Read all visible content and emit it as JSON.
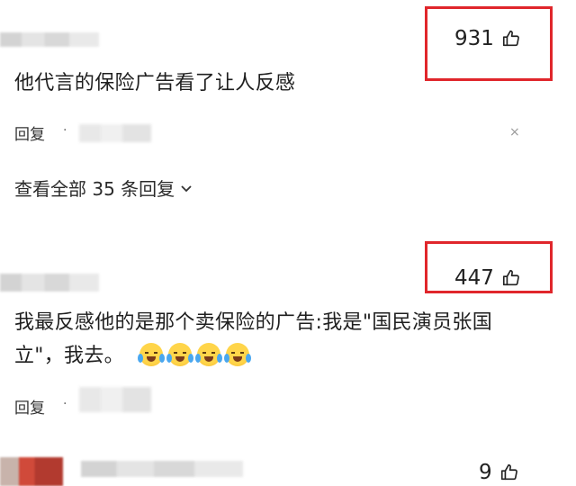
{
  "comments": [
    {
      "text": "他代言的保险广告看了让人反感",
      "likes": "931",
      "reply_label": "回复",
      "dot": "·",
      "close": "×",
      "view_all": "查看全部 35 条回复"
    },
    {
      "text_line1": "我最反感他的是那个卖保险的广告:我是\"国民演员张国",
      "text_line2": "立\"，我去。",
      "likes": "447",
      "reply_label": "回复",
      "dot": "·"
    },
    {
      "likes": "9"
    }
  ],
  "colors": {
    "highlight_box": "#e0262b"
  },
  "icons": {
    "like": "thumbs-up-icon",
    "expand": "chevron-down-icon",
    "close": "close-icon",
    "emoji": "crying-laughing-emoji"
  }
}
